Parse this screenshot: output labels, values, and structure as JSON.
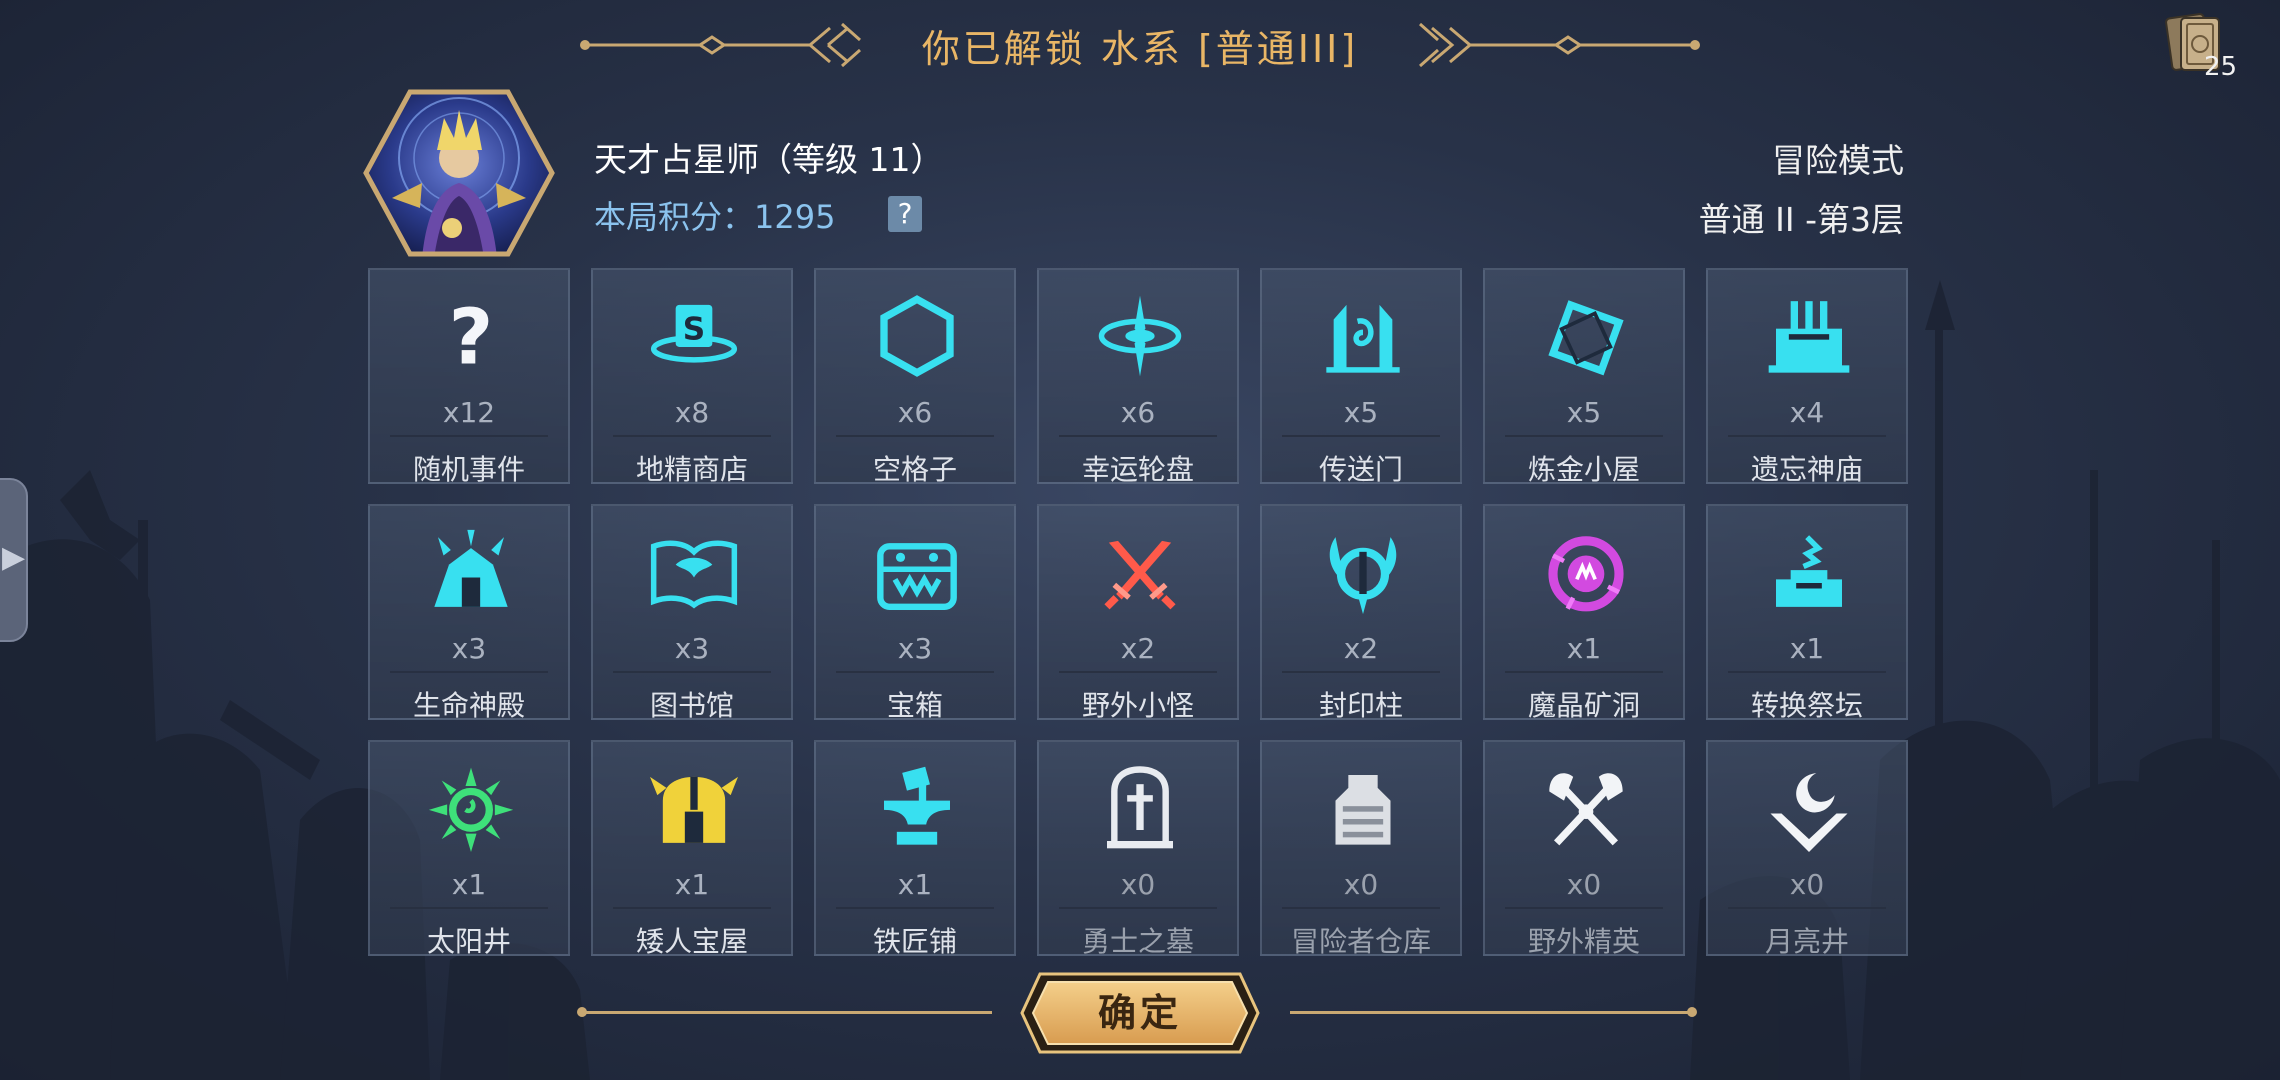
{
  "banner": {
    "title": "你已解锁 水系 [普通III]"
  },
  "deck": {
    "count": "25",
    "icon": "card-deck-icon"
  },
  "player": {
    "name": "天才占星师（等级 11）",
    "score_label": "本局积分：1295",
    "help": "?"
  },
  "mode": {
    "label": "冒险模式",
    "floor": "普通 II -第3层"
  },
  "colors": {
    "accent": "#e9b666",
    "cyan": "#38e0f0",
    "score": "#8bc3ee",
    "button": "#e8b56a"
  },
  "grid": [
    {
      "name": "随机事件",
      "count": "x12",
      "icon": "question-mark-icon"
    },
    {
      "name": "地精商店",
      "count": "x8",
      "icon": "goblin-shop-icon"
    },
    {
      "name": "空格子",
      "count": "x6",
      "icon": "hexagon-icon"
    },
    {
      "name": "幸运轮盘",
      "count": "x6",
      "icon": "lucky-wheel-icon"
    },
    {
      "name": "传送门",
      "count": "x5",
      "icon": "portal-icon"
    },
    {
      "name": "炼金小屋",
      "count": "x5",
      "icon": "alchemy-hut-icon"
    },
    {
      "name": "遗忘神庙",
      "count": "x4",
      "icon": "forgotten-temple-icon"
    },
    {
      "name": "生命神殿",
      "count": "x3",
      "icon": "life-shrine-icon"
    },
    {
      "name": "图书馆",
      "count": "x3",
      "icon": "library-book-icon"
    },
    {
      "name": "宝箱",
      "count": "x3",
      "icon": "treasure-chest-icon"
    },
    {
      "name": "野外小怪",
      "count": "x2",
      "icon": "crossed-swords-icon"
    },
    {
      "name": "封印柱",
      "count": "x2",
      "icon": "seal-pillar-icon"
    },
    {
      "name": "魔晶矿洞",
      "count": "x1",
      "icon": "magic-crystal-mine-icon"
    },
    {
      "name": "转换祭坛",
      "count": "x1",
      "icon": "transform-altar-icon"
    },
    {
      "name": "太阳井",
      "count": "x1",
      "icon": "sun-well-icon"
    },
    {
      "name": "矮人宝屋",
      "count": "x1",
      "icon": "dwarf-treasure-house-icon"
    },
    {
      "name": "铁匠铺",
      "count": "x1",
      "icon": "anvil-icon"
    },
    {
      "name": "勇士之墓",
      "count": "x0",
      "icon": "tombstone-icon"
    },
    {
      "name": "冒险者仓库",
      "count": "x0",
      "icon": "adventurer-warehouse-icon"
    },
    {
      "name": "野外精英",
      "count": "x0",
      "icon": "crossed-axes-icon"
    },
    {
      "name": "月亮井",
      "count": "x0",
      "icon": "moon-well-icon"
    }
  ],
  "confirm": {
    "label": "确定"
  }
}
